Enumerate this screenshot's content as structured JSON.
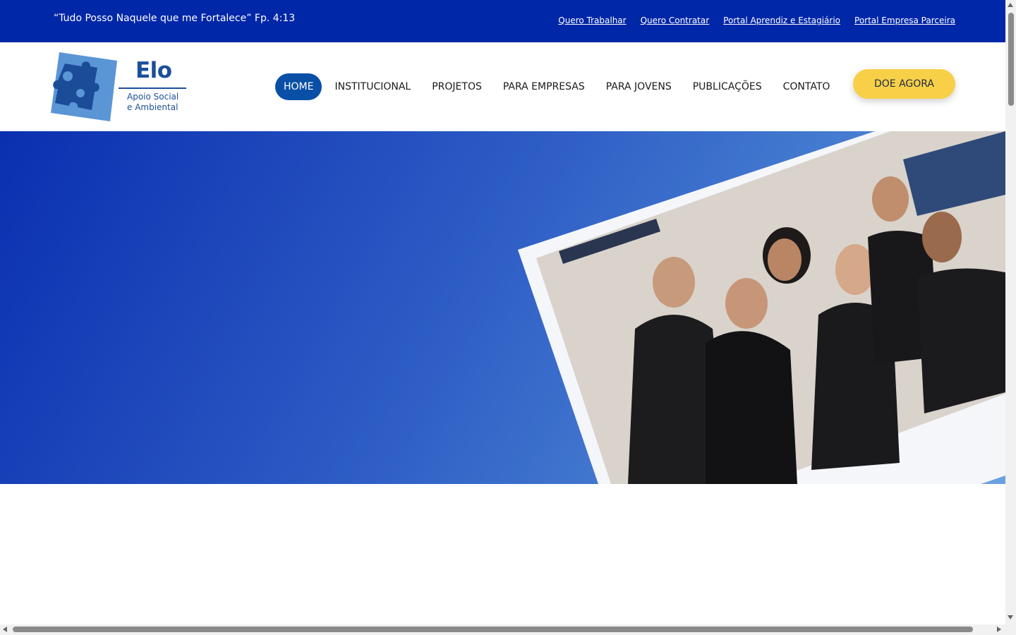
{
  "topbar": {
    "verse": "“Tudo Posso Naquele que me Fortalece” Fp. 4:13",
    "links": [
      "Quero Trabalhar",
      "Quero Contratar",
      "Portal Aprendiz e Estagiário",
      "Portal Empresa Parceira"
    ]
  },
  "logo": {
    "name": "Elo",
    "subtitle_line1": "Apoio Social",
    "subtitle_line2": "e Ambiental",
    "icon": "puzzle-piece-icon"
  },
  "nav": {
    "items": [
      "HOME",
      "INSTITUCIONAL",
      "PROJETOS",
      "PARA EMPRESAS",
      "PARA JOVENS",
      "PUBLICAÇÕES",
      "CONTATO"
    ],
    "active": "HOME",
    "donate_label": "DOE AGORA"
  },
  "colors": {
    "topbar": "#0027a8",
    "nav_active": "#0a4fa6",
    "donate": "#f7d047",
    "brand": "#1c4f9c"
  }
}
